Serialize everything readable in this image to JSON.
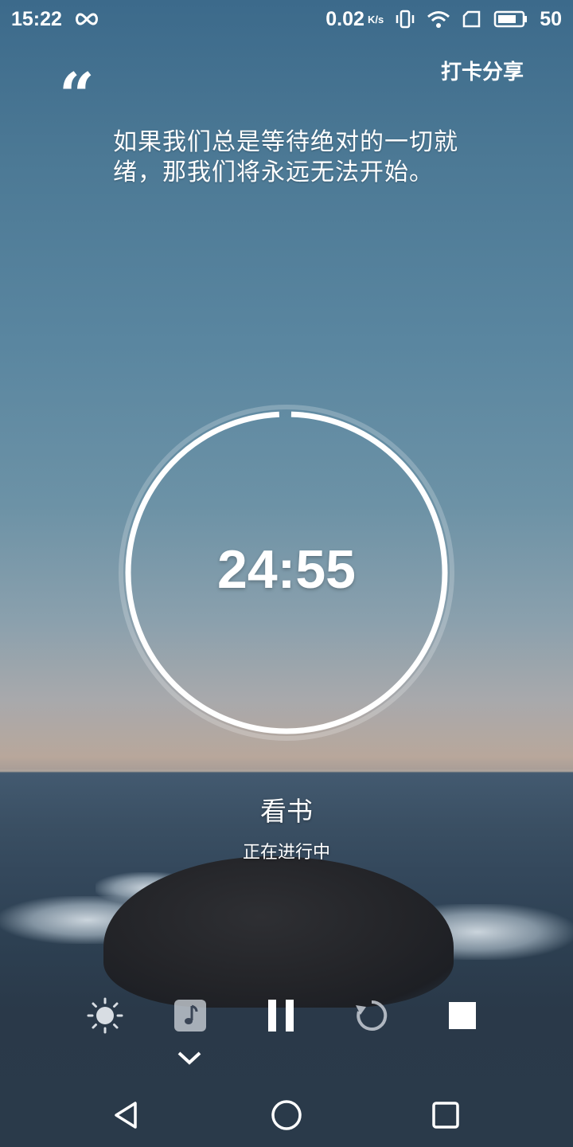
{
  "status_bar": {
    "time": "15:22",
    "net_speed": "0.02",
    "net_unit": "K/s",
    "battery": "50"
  },
  "header": {
    "share_label": "打卡分享"
  },
  "quote": {
    "mark": "“",
    "text": "如果我们总是等待绝对的一切就绪，那我们将永远无法开始。"
  },
  "timer": {
    "time": "24:55",
    "progress": 0.997
  },
  "task": {
    "name": "看书",
    "status": "正在进行中"
  },
  "controls": {
    "icons": [
      "brightness-icon",
      "music-note-icon",
      "pause-icon",
      "restart-icon",
      "stop-icon"
    ]
  },
  "colors": {
    "accent": "#ffffff",
    "ring_track": "rgba(255,255,255,0.25)"
  }
}
